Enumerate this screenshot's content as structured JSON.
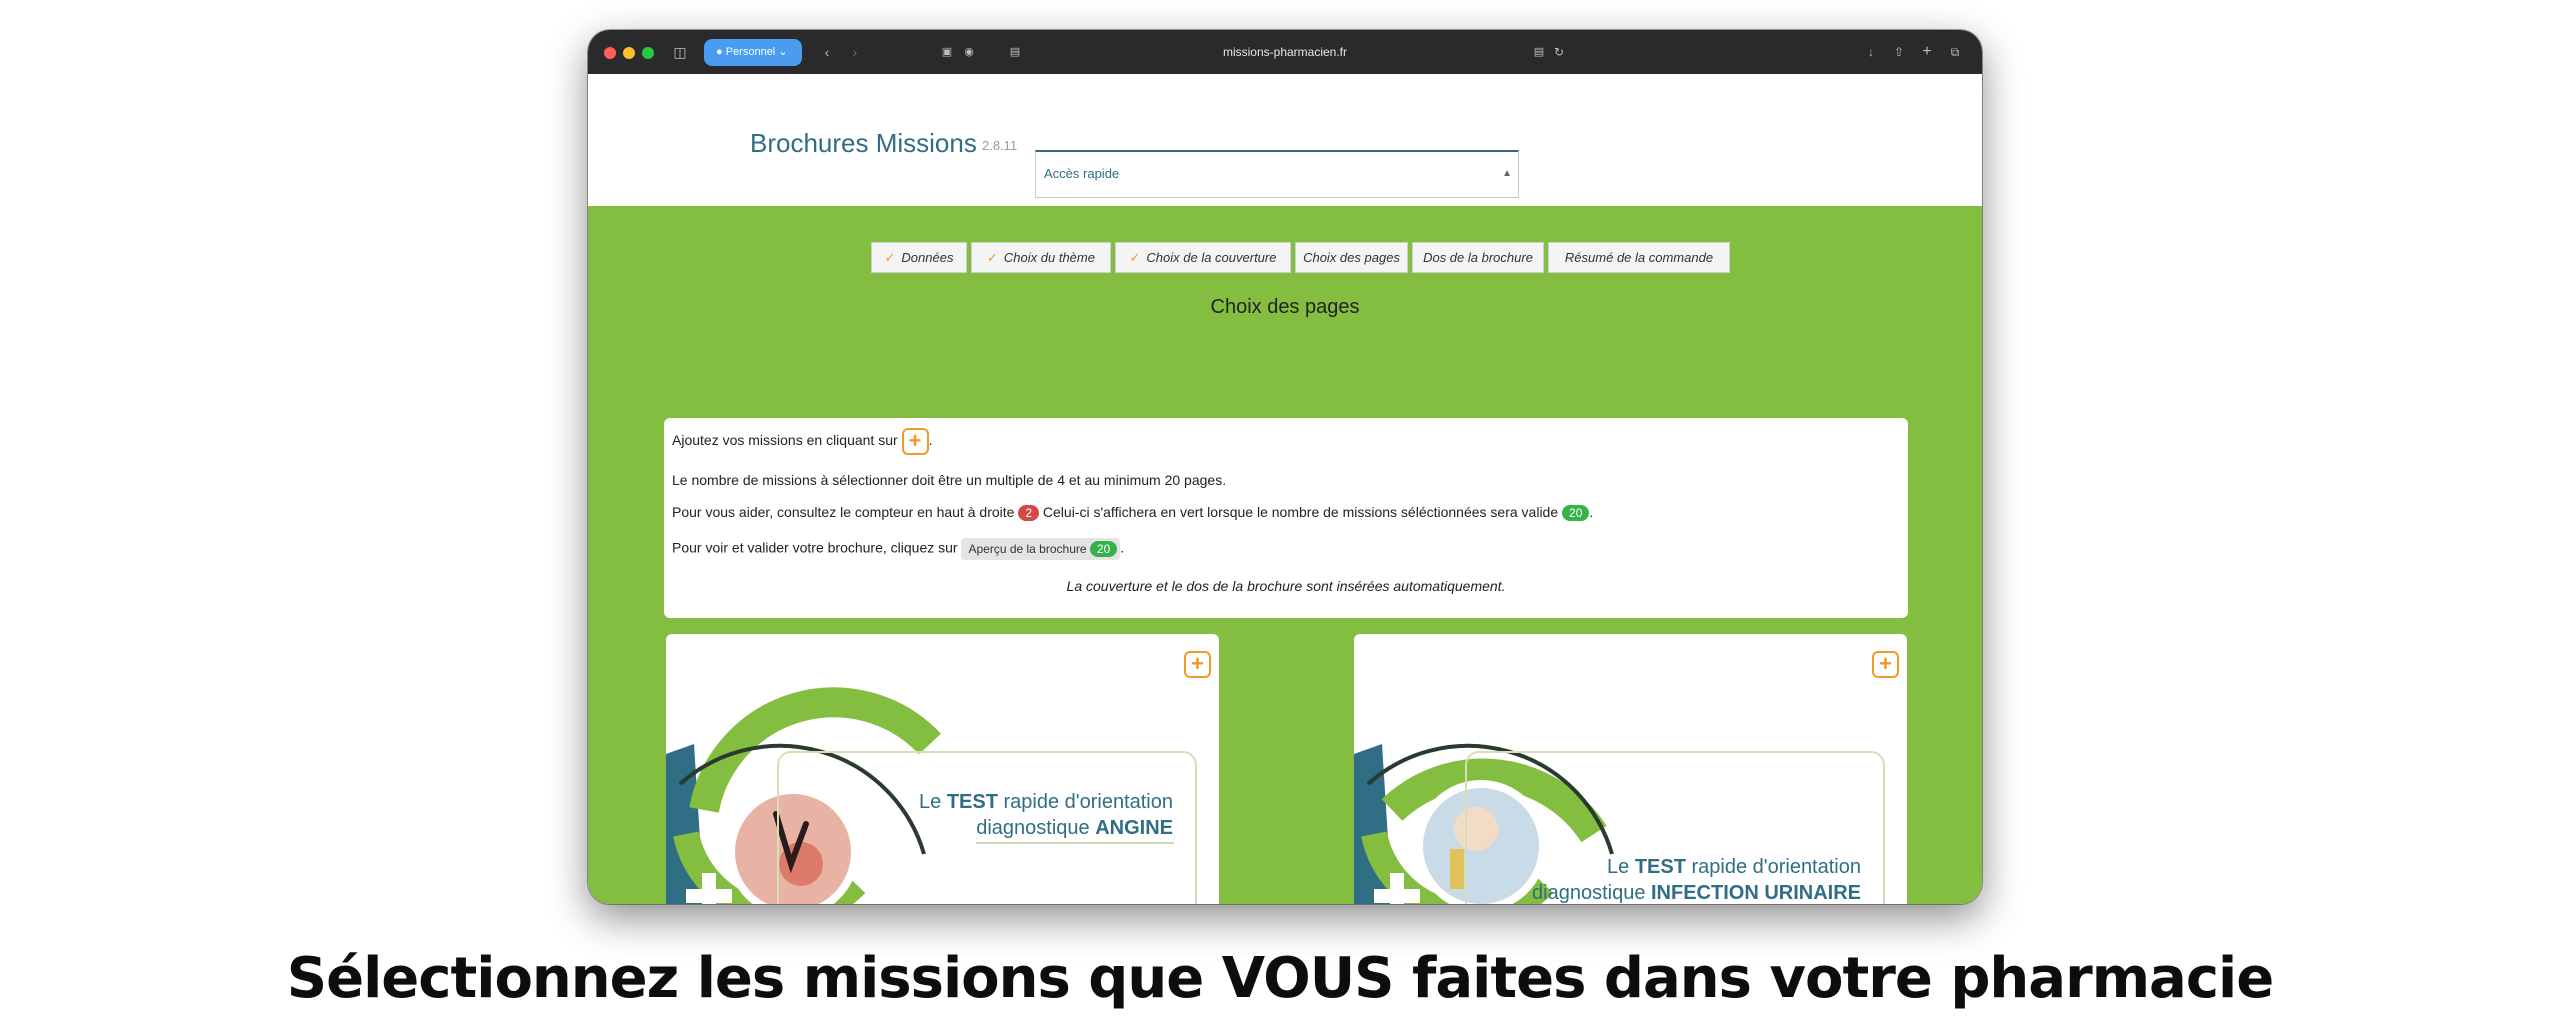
{
  "browser": {
    "profile_label": "Personnel",
    "url": "missions-pharmacien.fr"
  },
  "header": {
    "title": "Brochures Missions",
    "version": "2.8.11",
    "quick_access": "Accès rapide"
  },
  "steps": [
    {
      "label": "Données",
      "done": true
    },
    {
      "label": "Choix du thème",
      "done": true
    },
    {
      "label": "Choix de la couverture",
      "done": true
    },
    {
      "label": "Choix des pages",
      "done": false
    },
    {
      "label": "Dos de la brochure",
      "done": false
    },
    {
      "label": "Résumé de la commande",
      "done": false
    }
  ],
  "section_title": "Choix des pages",
  "info": {
    "line1_before": "Ajoutez vos missions en cliquant sur",
    "line1_after": ".",
    "line2": "Le nombre de missions à sélectionner doit être un multiple de 4 et au minimum 20 pages.",
    "line3_before": "Pour vous aider, consultez le compteur en haut à droite",
    "counter_red": "2",
    "line3_middle": "Celui-ci s'affichera en vert lorsque le nombre de missions séléctionnées sera valide",
    "counter_green": "20",
    "line3_after": ".",
    "line4_before": "Pour voir et valider votre brochure, cliquez sur",
    "apercu_label": "Aperçu de la brochure",
    "apercu_count": "20",
    "line4_after": ".",
    "note": "La couverture et le dos de la brochure sont insérées automatiquement."
  },
  "cards": [
    {
      "line1_pre": "Le ",
      "line1_bold": "TEST",
      "line1_post": " rapide d'orientation",
      "line2_pre": "diagnostique ",
      "line2_bold": "ANGINE"
    },
    {
      "line1_pre": "Le ",
      "line1_bold": "TEST",
      "line1_post": " rapide d'orientation",
      "line2_pre": "diagnostique ",
      "line2_bold": "INFECTION URINAIRE"
    }
  ],
  "slogan": "Sélectionnez les missions que VOUS faites dans votre pharmacie",
  "colors": {
    "green": "#84be41",
    "teal": "#2f6e84",
    "orange": "#f09a2a"
  }
}
